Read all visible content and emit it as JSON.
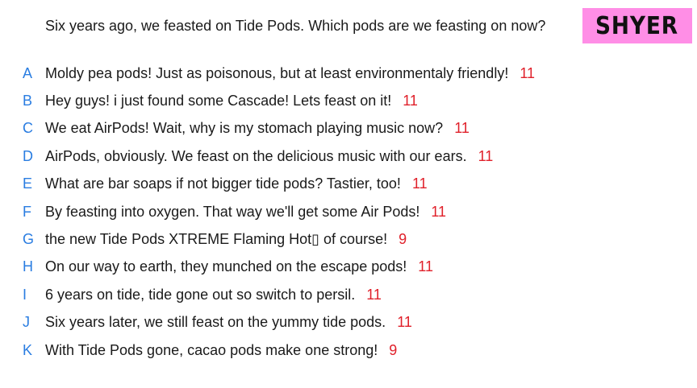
{
  "badge": {
    "label": "SHYER",
    "background": "#ff8ee6"
  },
  "prompt": "Six years ago, we feasted on Tide Pods. Which pods are we feasting on now?",
  "colors": {
    "letter": "#2a7de1",
    "votes": "#e0202a",
    "text": "#1a1a1a"
  },
  "answers": [
    {
      "letter": "A",
      "text": "Moldy pea pods! Just as poisonous, but at least environmentaly friendly!",
      "votes": "11"
    },
    {
      "letter": "B",
      "text": "Hey guys! i just found some Cascade! Lets feast on it!",
      "votes": "11"
    },
    {
      "letter": "C",
      "text": "We eat AirPods! Wait, why is my stomach playing music now?",
      "votes": "11"
    },
    {
      "letter": "D",
      "text": "AirPods, obviously. We feast on the delicious music with our ears.",
      "votes": "11"
    },
    {
      "letter": "E",
      "text": "What are bar soaps if not bigger tide pods? Tastier, too!",
      "votes": "11"
    },
    {
      "letter": "F",
      "text": "By feasting into oxygen. That way we'll get some Air Pods!",
      "votes": "11"
    },
    {
      "letter": "G",
      "text": "the new Tide Pods XTREME Flaming Hot▯ of course!",
      "votes": "9"
    },
    {
      "letter": "H",
      "text": "On our way to earth, they munched on the escape pods!",
      "votes": "11"
    },
    {
      "letter": "I",
      "text": "6 years on tide, tide gone out so switch to persil.",
      "votes": "11"
    },
    {
      "letter": "J",
      "text": "Six years later, we still feast on the yummy tide pods.",
      "votes": "11"
    },
    {
      "letter": "K",
      "text": "With Tide Pods gone, cacao pods make one strong!",
      "votes": "9"
    }
  ]
}
